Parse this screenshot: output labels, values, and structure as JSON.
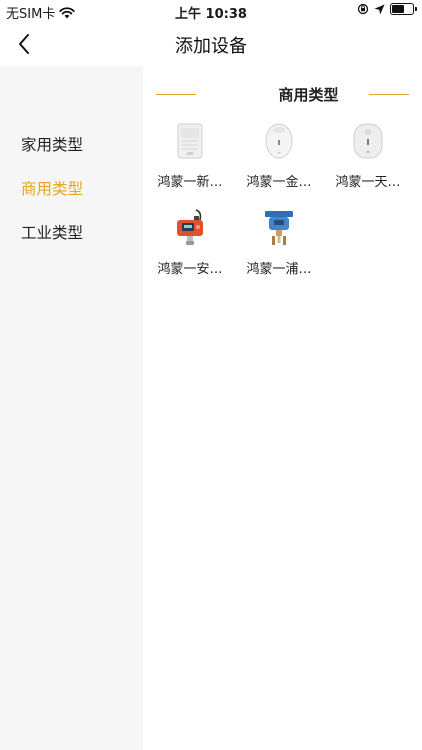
{
  "status_bar": {
    "carrier": "无SIM卡",
    "time": "上午 10:38",
    "battery_level": 0.55
  },
  "nav": {
    "title": "添加设备",
    "back_icon": "chevron-left-icon"
  },
  "sidebar": {
    "items": [
      {
        "label": "家用类型",
        "active": false
      },
      {
        "label": "商用类型",
        "active": true
      },
      {
        "label": "工业类型",
        "active": false
      }
    ]
  },
  "section": {
    "title": "商用类型"
  },
  "devices": [
    {
      "label": "鸿蒙一新…",
      "icon": "wall-detector-icon"
    },
    {
      "label": "鸿蒙一金…",
      "icon": "oval-detector-icon"
    },
    {
      "label": "鸿蒙一天…",
      "icon": "round-detector-icon"
    },
    {
      "label": "鸿蒙一安…",
      "icon": "industrial-gas-detector-icon"
    },
    {
      "label": "鸿蒙一浦…",
      "icon": "pressure-transmitter-icon"
    }
  ],
  "colors": {
    "accent": "#e8a521",
    "sidebar_bg": "#f6f6f6",
    "panel_bg": "#ffffff"
  }
}
